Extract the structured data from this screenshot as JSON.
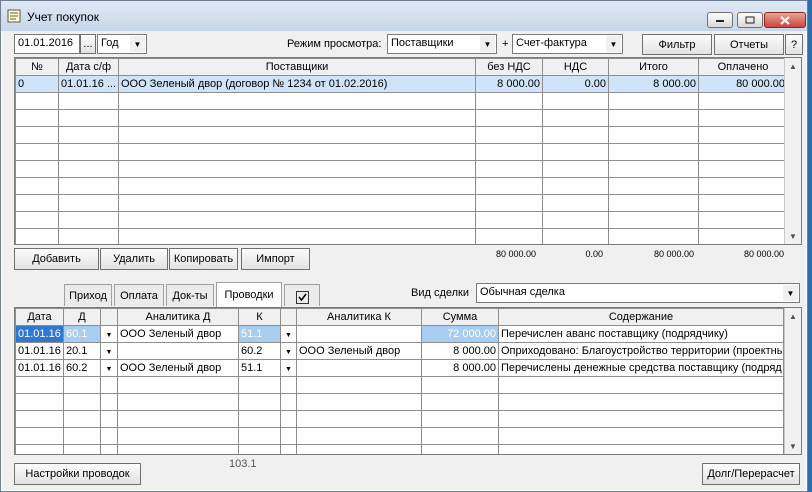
{
  "window": {
    "title": "Учет покупок"
  },
  "toolbar": {
    "date_value": "01.01.2016",
    "date_picker_label": "...",
    "period_value": "Год",
    "view_mode_label": "Режим просмотра:",
    "view_mode_value": "Поставщики",
    "plus_label": "+",
    "doc_type_value": "Счет-фактура",
    "filter_label": "Фильтр",
    "reports_label": "Отчеты",
    "help_label": "?"
  },
  "invoices": {
    "columns": [
      "№",
      "Дата с/ф",
      "Поставщики",
      "без НДС",
      "НДС",
      "Итого",
      "Оплачено"
    ],
    "rows": [
      {
        "num": "0",
        "date": "01.01.16 ...",
        "supplier": "ООО Зеленый двор (договор № 1234 от 01.02.2016)",
        "net": "8 000.00",
        "vat": "0.00",
        "total": "8 000.00",
        "paid": "80 000.00"
      }
    ],
    "totals": {
      "net": "80 000.00",
      "vat": "0.00",
      "total": "80 000.00",
      "paid": "80 000.00"
    }
  },
  "actions": {
    "add": "Добавить",
    "delete": "Удалить",
    "copy": "Копировать",
    "import": "Импорт"
  },
  "tabs": [
    "Приход",
    "Оплата",
    "Док-ты",
    "Проводки"
  ],
  "deal": {
    "label": "Вид сделки",
    "value": "Обычная сделка"
  },
  "postings": {
    "columns": [
      "Дата",
      "Д",
      "Аналитика Д",
      "К",
      "Аналитика К",
      "Сумма",
      "Содержание"
    ],
    "rows": [
      {
        "date": "01.01.16",
        "d": "60.1",
        "an_d": "ООО Зеленый двор",
        "k": "51.1",
        "an_k": "",
        "sum": "72 000.00",
        "desc": "Перечислен аванс поставщику (подрядчику)"
      },
      {
        "date": "01.01.16",
        "d": "20.1",
        "an_d": "",
        "k": "60.2",
        "an_k": "ООО Зеленый двор",
        "sum": "8 000.00",
        "desc": "Оприходовано: Благоустройство территории (проектны"
      },
      {
        "date": "01.01.16",
        "d": "60.2",
        "an_d": "ООО Зеленый двор",
        "k": "51.1",
        "an_k": "",
        "sum": "8 000.00",
        "desc": "Перечислены денежные средства поставщику (подряд"
      }
    ]
  },
  "footer": {
    "settings": "Настройки проводок",
    "account_code": "103.1",
    "debt": "Долг/Перерасчет"
  }
}
